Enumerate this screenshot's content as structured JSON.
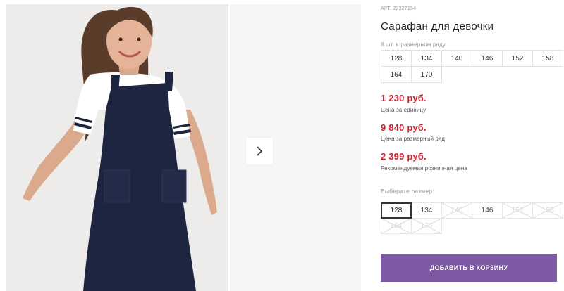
{
  "gallery": {
    "next_icon": "chevron-right-icon"
  },
  "product": {
    "article_label": "АРТ.",
    "article_number": "22327154",
    "title": "Сарафан для девочки"
  },
  "pack": {
    "caption": "8 шт. в размерном ряду",
    "sizes": [
      "128",
      "134",
      "140",
      "146",
      "152",
      "158",
      "164",
      "170"
    ]
  },
  "prices": {
    "unit": {
      "value": "1 230 руб.",
      "label": "Цена за единицу"
    },
    "pack": {
      "value": "9 840 руб.",
      "label": "Цена за размерный ряд"
    },
    "retail": {
      "value": "2 399 руб.",
      "label": "Рекомендуемая розничная цена"
    }
  },
  "size_select": {
    "caption": "Выберите размер:",
    "options": [
      {
        "label": "128",
        "state": "selected"
      },
      {
        "label": "134",
        "state": "available"
      },
      {
        "label": "140",
        "state": "unavailable"
      },
      {
        "label": "146",
        "state": "available"
      },
      {
        "label": "152",
        "state": "unavailable"
      },
      {
        "label": "158",
        "state": "unavailable"
      },
      {
        "label": "164",
        "state": "unavailable"
      },
      {
        "label": "170",
        "state": "unavailable"
      }
    ]
  },
  "cart": {
    "add_label": "ДОБАВИТЬ В КОРЗИНУ"
  },
  "colors": {
    "price_red": "#d41e2c",
    "button_purple": "#7d5aa3",
    "dress_navy": "#1e2540",
    "shirt_white": "#ffffff"
  }
}
